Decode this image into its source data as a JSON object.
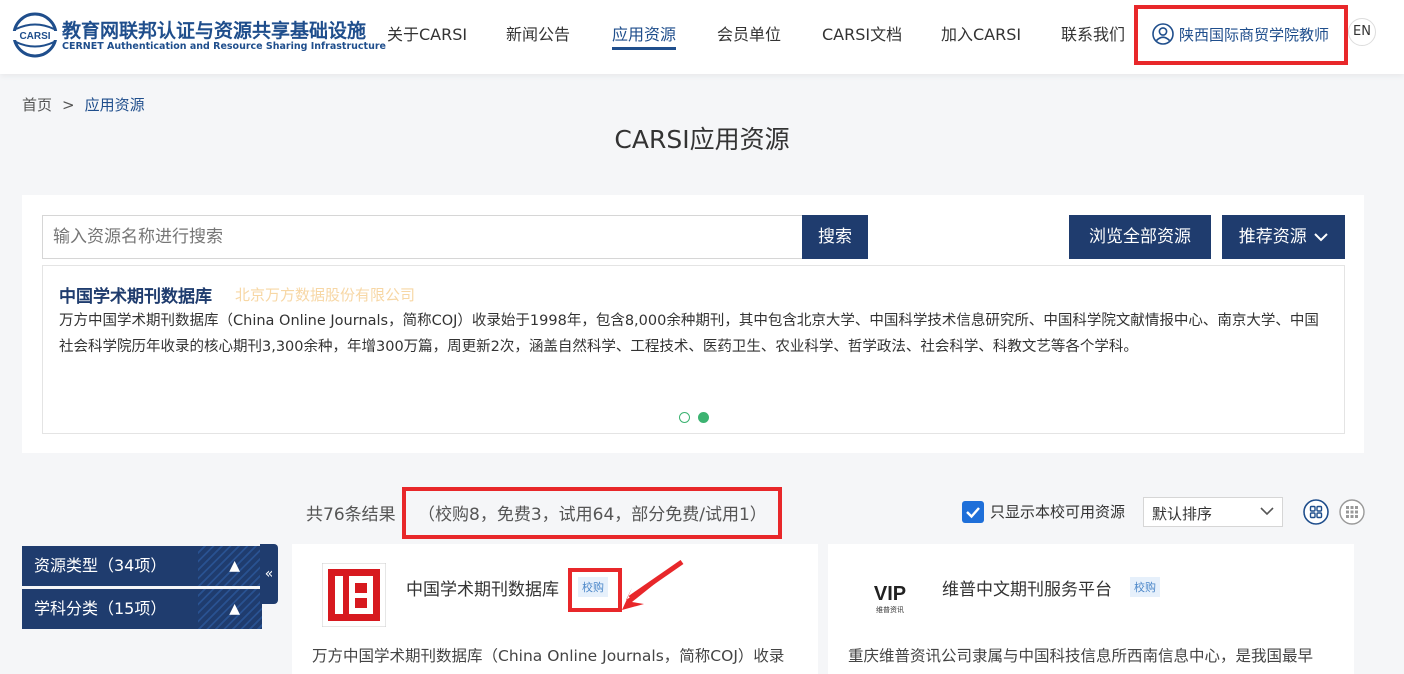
{
  "header": {
    "logo_cn": "教育网联邦认证与资源共享基础设施",
    "logo_en": "CERNET Authentication and Resource Sharing Infrastructure",
    "logo_mark_text": "CARSI",
    "nav": [
      {
        "label": "关于CARSI"
      },
      {
        "label": "新闻公告"
      },
      {
        "label": "应用资源"
      },
      {
        "label": "会员单位"
      },
      {
        "label": "CARSI文档"
      },
      {
        "label": "加入CARSI"
      },
      {
        "label": "联系我们"
      }
    ],
    "active_nav": "应用资源",
    "user": "陕西国际商贸学院教师",
    "lang": "EN"
  },
  "breadcrumb": {
    "home": "首页",
    "sep": ">",
    "current": "应用资源"
  },
  "page_title": "CARSI应用资源",
  "search": {
    "placeholder": "输入资源名称进行搜索",
    "button": "搜索",
    "browse_all": "浏览全部资源",
    "recommend": "推荐资源"
  },
  "featured": {
    "title": "中国学术期刊数据库",
    "publisher": "北京万方数据股份有限公司",
    "description": "万方中国学术期刊数据库（China Online Journals，简称COJ）收录始于1998年，包含8,000余种期刊，其中包含北京大学、中国科学技术信息研究所、中国科学院文献情报中心、南京大学、中国社会科学院历年收录的核心期刊3,300余种，年增300万篇，周更新2次，涵盖自然科学、工程技术、医药卫生、农业科学、哲学政法、社会科学、科教文艺等各个学科。",
    "slides_total": 2,
    "slide_active": 2
  },
  "results": {
    "count": "共76条结果",
    "detail": "（校购8，免费3，试用64，部分免费/试用1）",
    "only_school_label": "只显示本校可用资源",
    "only_school_checked": true,
    "sort": "默认排序"
  },
  "filters": [
    {
      "label": "资源类型（34项）",
      "arrow": "▲"
    },
    {
      "label": "学科分类（15项）",
      "arrow": "▲"
    }
  ],
  "collapse_icon": "«",
  "resources": [
    {
      "name": "中国学术期刊数据库",
      "badge": "校购",
      "desc": "万方中国学术期刊数据库（China Online Journals，简称COJ）收录"
    },
    {
      "name": "维普中文期刊服务平台",
      "badge": "校购",
      "desc": "重庆维普资讯公司隶属与中国科技信息所西南信息中心，是我国最早",
      "logo_text": "VIP",
      "logo_sub": "维普资讯"
    }
  ],
  "colors": {
    "navy": "#1f3c6e",
    "brand_blue": "#1f4e8c",
    "highlight_red": "#e8272a",
    "carousel_green": "#3cb371"
  }
}
